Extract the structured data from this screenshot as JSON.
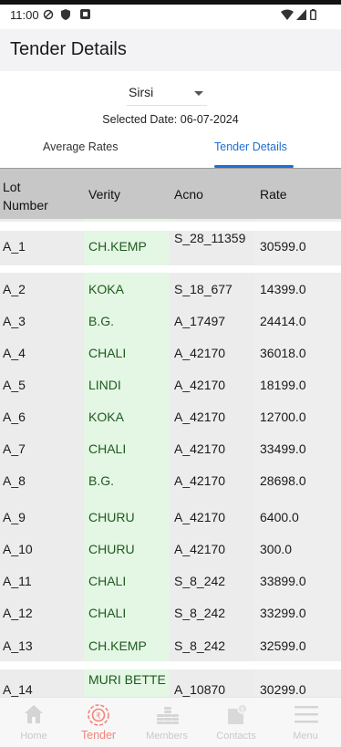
{
  "status_bar": {
    "time": "11:00"
  },
  "header": {
    "title": "Tender Details"
  },
  "filters": {
    "location": "Sirsi",
    "selected_date": "Selected Date: 06-07-2024"
  },
  "tabs": [
    {
      "label": "Average Rates",
      "active": false
    },
    {
      "label": "Tender Details",
      "active": true
    }
  ],
  "table": {
    "headers": [
      "Lot Number",
      "Verity",
      "Acno",
      "Rate"
    ],
    "rows": [
      {
        "lot": "A_1",
        "verity": "CH.KEMP",
        "acno": "S_28_11359",
        "rate": "30599.0"
      },
      {
        "lot": "A_2",
        "verity": "KOKA",
        "acno": "S_18_677",
        "rate": "14399.0"
      },
      {
        "lot": "A_3",
        "verity": "B.G.",
        "acno": "A_17497",
        "rate": "24414.0"
      },
      {
        "lot": "A_4",
        "verity": "CHALI",
        "acno": "A_42170",
        "rate": "36018.0"
      },
      {
        "lot": "A_5",
        "verity": "LINDI",
        "acno": "A_42170",
        "rate": "18199.0"
      },
      {
        "lot": "A_6",
        "verity": "KOKA",
        "acno": "A_42170",
        "rate": "12700.0"
      },
      {
        "lot": "A_7",
        "verity": "CHALI",
        "acno": "A_42170",
        "rate": "33499.0"
      },
      {
        "lot": "A_8",
        "verity": "B.G.",
        "acno": "A_42170",
        "rate": "28698.0"
      },
      {
        "lot": "A_9",
        "verity": "CHURU",
        "acno": "A_42170",
        "rate": "6400.0"
      },
      {
        "lot": "A_10",
        "verity": "CHURU",
        "acno": "A_42170",
        "rate": "300.0"
      },
      {
        "lot": "A_11",
        "verity": "CHALI",
        "acno": "S_8_242",
        "rate": "33899.0"
      },
      {
        "lot": "A_12",
        "verity": "CHALI",
        "acno": "S_8_242",
        "rate": "33299.0"
      },
      {
        "lot": "A_13",
        "verity": "CH.KEMP",
        "acno": "S_8_242",
        "rate": "32599.0"
      },
      {
        "lot": "A_14",
        "verity": "MURI BETTE",
        "acno": "A_10870",
        "rate": "30299.0"
      }
    ]
  },
  "bottom_nav": [
    {
      "label": "Home",
      "icon": "home-icon",
      "active": false
    },
    {
      "label": "Tender",
      "icon": "tender-icon",
      "active": true
    },
    {
      "label": "Members",
      "icon": "members-icon",
      "active": false
    },
    {
      "label": "Contacts",
      "icon": "contacts-icon",
      "active": false
    },
    {
      "label": "Menu",
      "icon": "menu-icon",
      "active": false
    }
  ],
  "colors": {
    "accent": "#1d6fd3",
    "nav_active": "#f0857a",
    "verity_bg": "#e4f6e4",
    "header_bg": "#c7c7c7"
  }
}
